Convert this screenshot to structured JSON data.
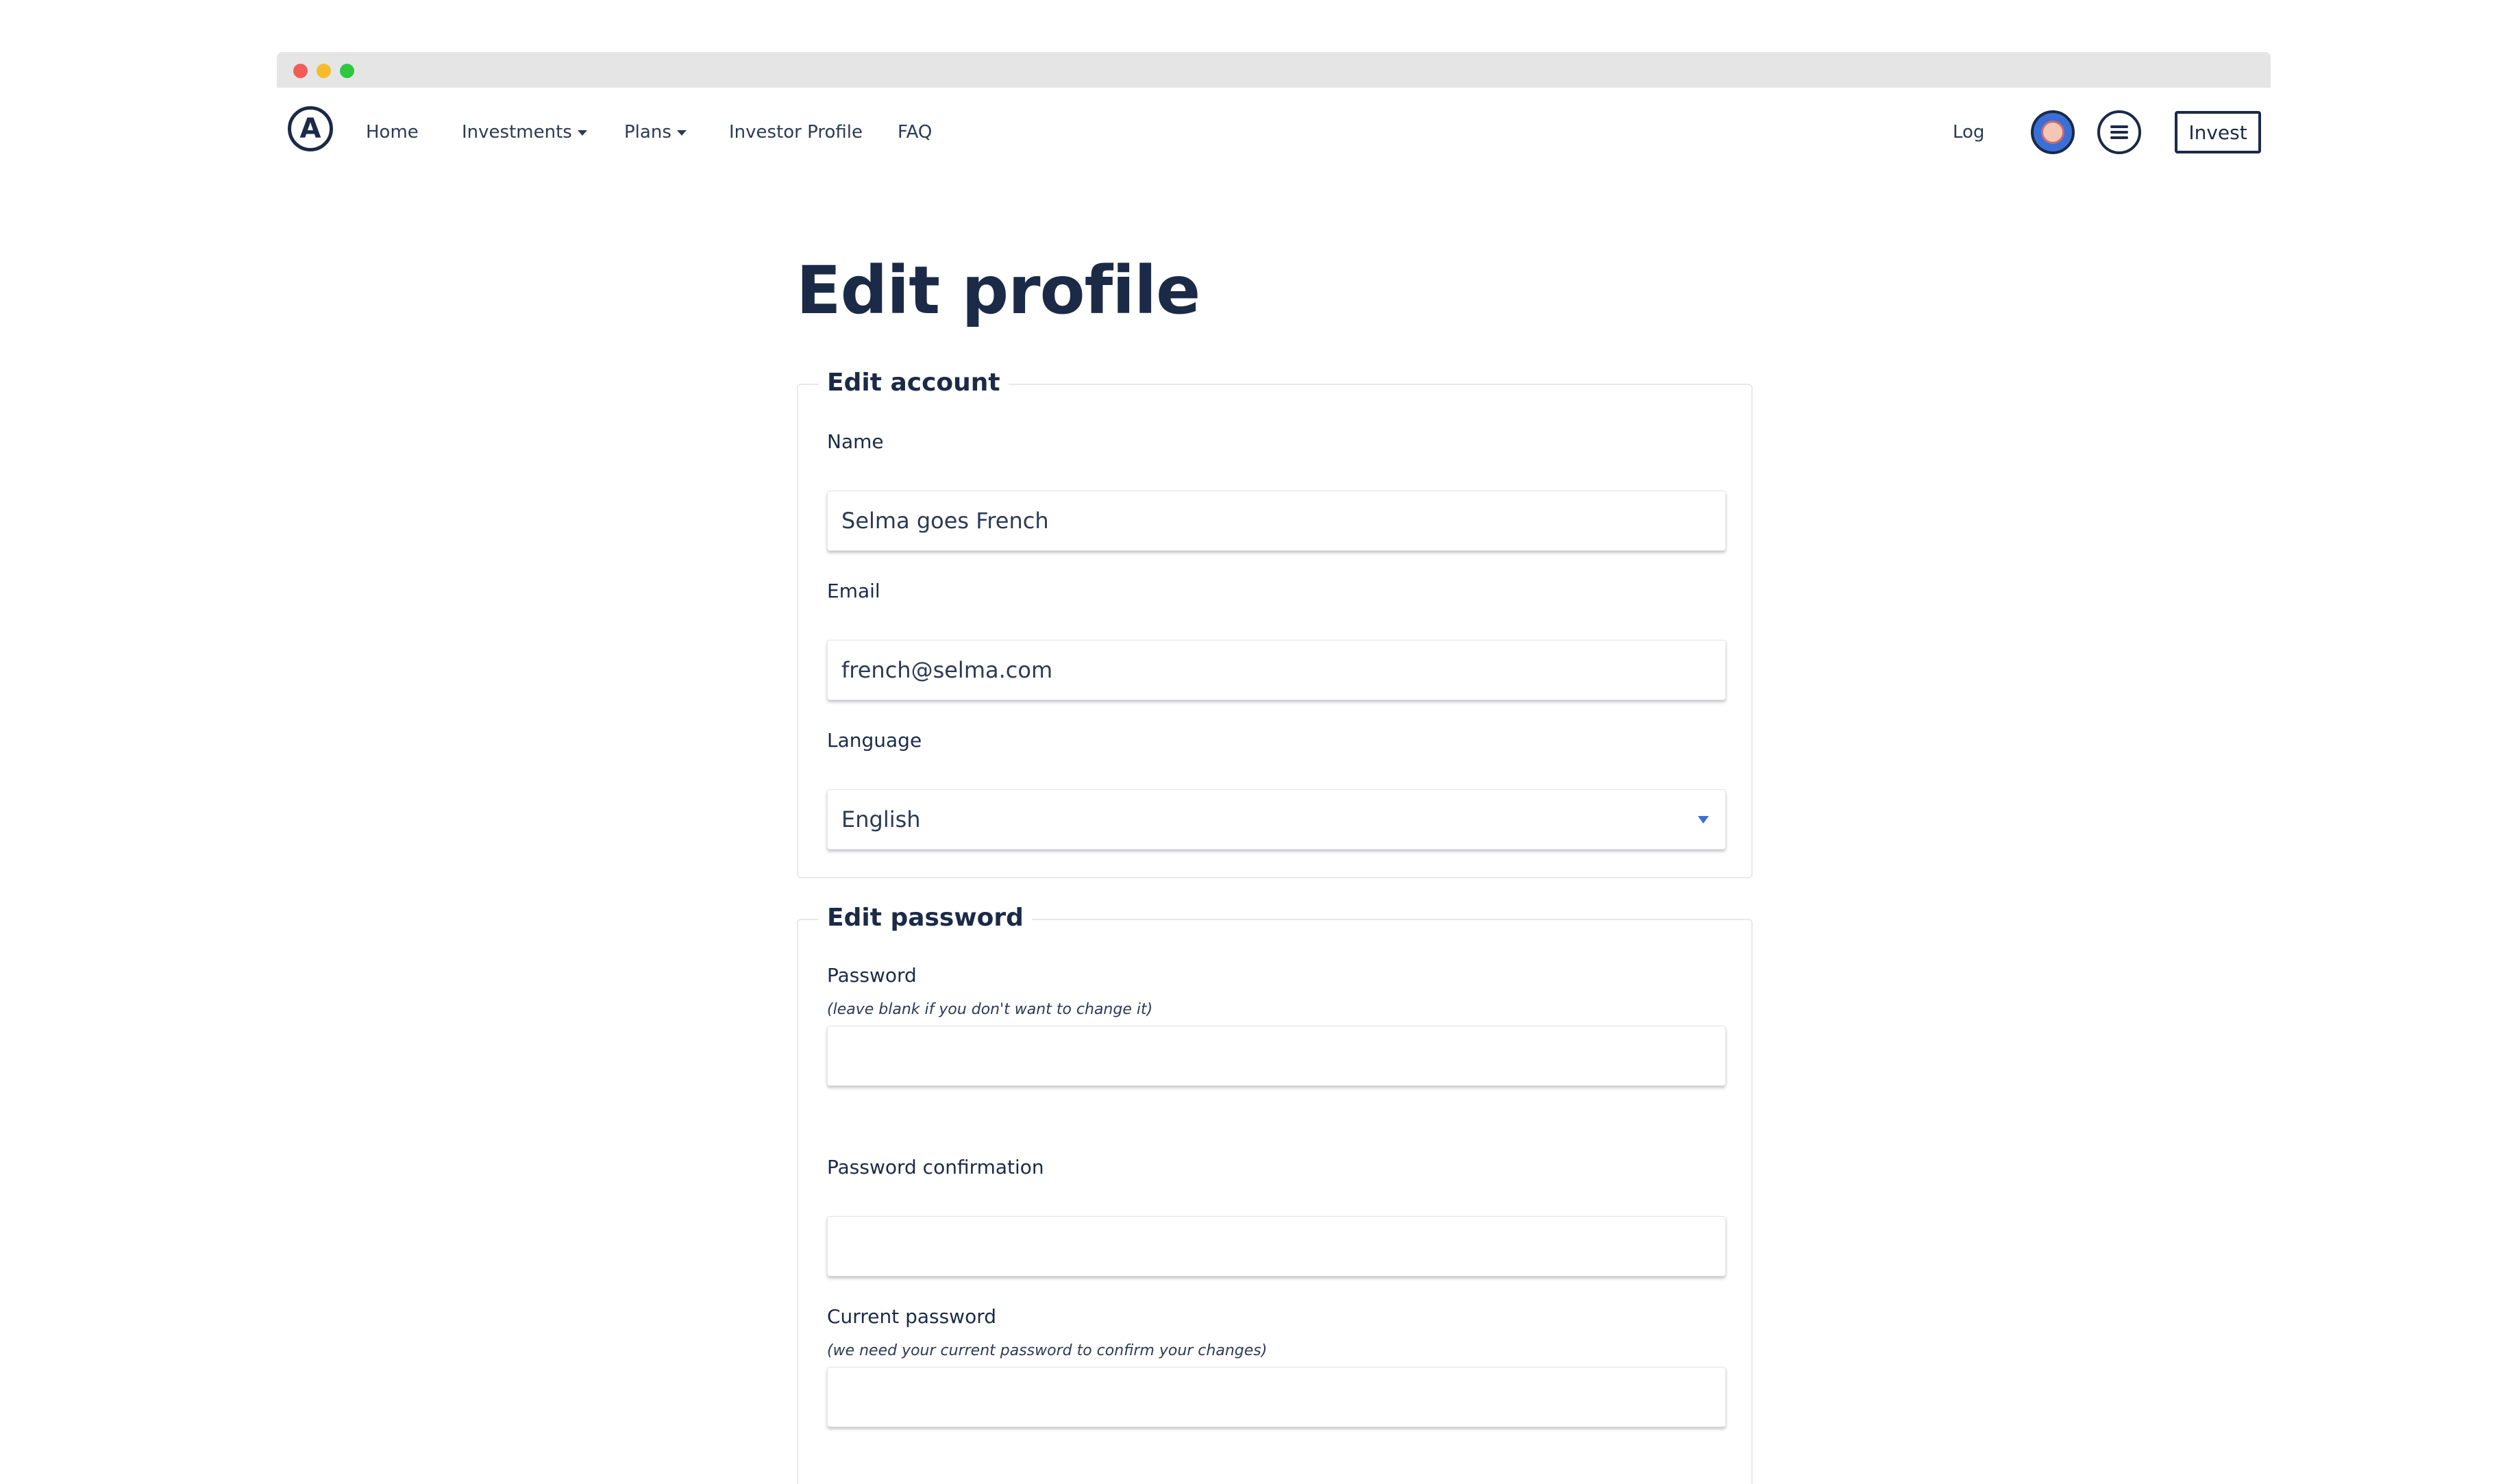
{
  "nav": {
    "logo_letter": "A",
    "items": [
      {
        "label": "Home"
      },
      {
        "label": "Investments"
      },
      {
        "label": "Plans"
      },
      {
        "label": "Investor Profile"
      },
      {
        "label": "FAQ"
      }
    ],
    "log_label": "Log",
    "invest_label": "Invest",
    "icons": {
      "logo": "logo-icon",
      "avatar": "avatar-icon",
      "menu": "hamburger-menu-icon",
      "dropdown": "caret-down-icon",
      "select": "triangle-down-icon"
    }
  },
  "page": {
    "title": "Edit profile"
  },
  "account": {
    "legend": "Edit account",
    "name_label": "Name",
    "name_value": "Selma goes French",
    "email_label": "Email",
    "email_value": "french@selma.com",
    "language_label": "Language",
    "language_value": "English"
  },
  "password": {
    "legend": "Edit password",
    "password_label": "Password",
    "password_hint": "(leave blank if you don't want to change it)",
    "confirmation_label": "Password confirmation",
    "current_label": "Current password",
    "current_hint": "(we need your current password to confirm your changes)"
  },
  "colors": {
    "text": "#1b2a47",
    "accent": "#3b6fd8",
    "chrome": "#e5e5e5"
  }
}
